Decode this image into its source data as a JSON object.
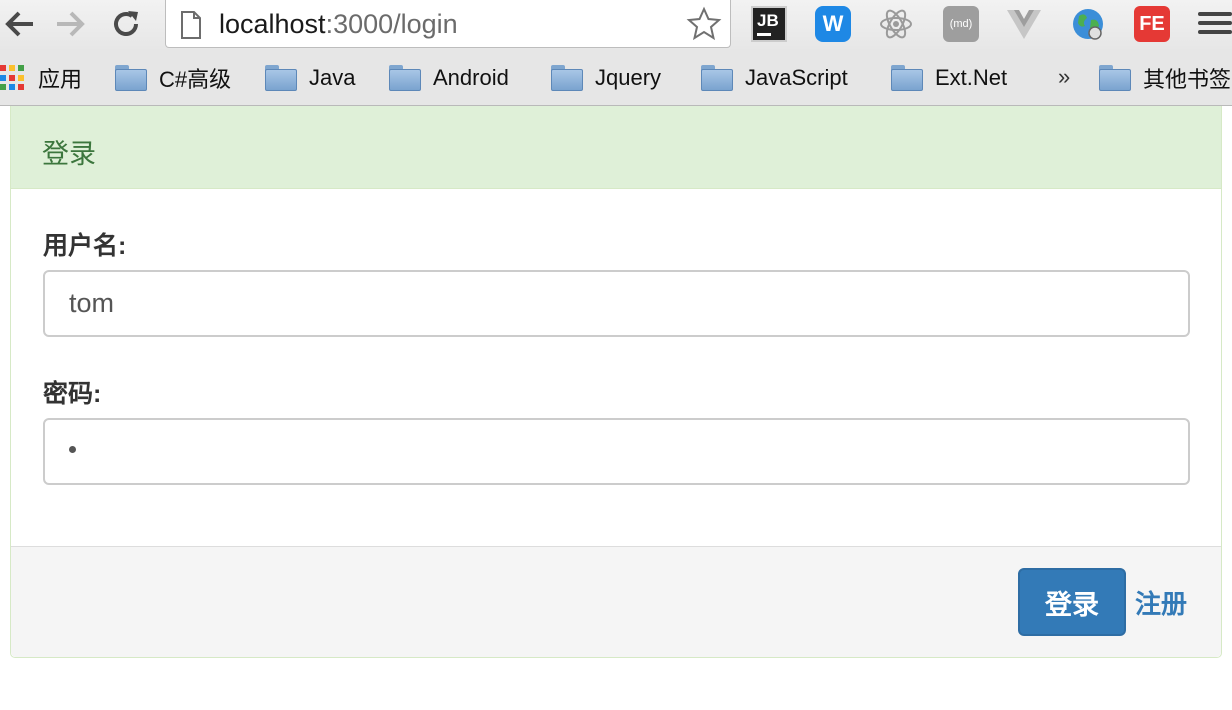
{
  "browser": {
    "url_host": "localhost",
    "url_rest": ":3000/login",
    "extensions": {
      "jb": "JB",
      "w": "W",
      "md": "(md)",
      "fe": "FE"
    },
    "bookmarks": {
      "apps": "应用",
      "items": [
        "C#高级",
        "Java",
        "Android",
        "Jquery",
        "JavaScript",
        "Ext.Net"
      ],
      "overflow": "»",
      "other": "其他书签"
    },
    "icons": [
      "back-icon",
      "forward-icon",
      "reload-icon",
      "page-icon",
      "star-icon",
      "react-icon",
      "vue-icon",
      "globe-icon",
      "menu-icon",
      "folder-icon",
      "apps-icon"
    ]
  },
  "login": {
    "title": "登录",
    "username_label": "用户名:",
    "username_value": "tom",
    "password_label": "密码:",
    "submit_label": "登录",
    "register_label": "注册"
  },
  "colors": {
    "heading_bg": "#dff0d8",
    "heading_text": "#3c763d",
    "primary": "#337ab7"
  }
}
